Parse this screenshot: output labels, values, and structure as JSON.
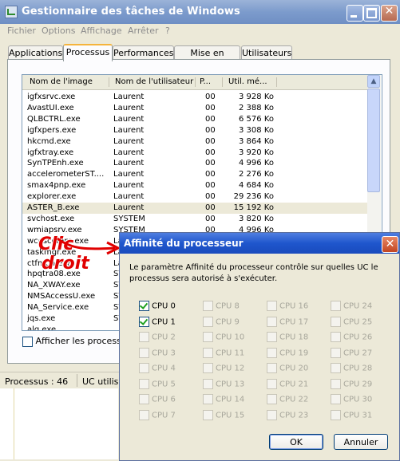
{
  "window": {
    "title": "Gestionnaire des tâches de Windows"
  },
  "menu": [
    "Fichier",
    "Options",
    "Affichage",
    "Arrêter",
    "?"
  ],
  "tabs": [
    "Applications",
    "Processus",
    "Performances",
    "Mise en réseau",
    "Utilisateurs"
  ],
  "active_tab": "Processus",
  "columns": [
    "Nom de l'image",
    "Nom de l'utilisateur",
    "P...",
    "Util. mé..."
  ],
  "processes": [
    {
      "name": "igfxsrvc.exe",
      "user": "Laurent",
      "cpu": "00",
      "mem": "3 928 Ko"
    },
    {
      "name": "AvastUI.exe",
      "user": "Laurent",
      "cpu": "00",
      "mem": "2 388 Ko"
    },
    {
      "name": "QLBCTRL.exe",
      "user": "Laurent",
      "cpu": "00",
      "mem": "6 576 Ko"
    },
    {
      "name": "igfxpers.exe",
      "user": "Laurent",
      "cpu": "00",
      "mem": "3 308 Ko"
    },
    {
      "name": "hkcmd.exe",
      "user": "Laurent",
      "cpu": "00",
      "mem": "3 864 Ko"
    },
    {
      "name": "igfxtray.exe",
      "user": "Laurent",
      "cpu": "00",
      "mem": "3 920 Ko"
    },
    {
      "name": "SynTPEnh.exe",
      "user": "Laurent",
      "cpu": "00",
      "mem": "4 996 Ko"
    },
    {
      "name": "accelerometerST....",
      "user": "Laurent",
      "cpu": "00",
      "mem": "2 276 Ko"
    },
    {
      "name": "smax4pnp.exe",
      "user": "Laurent",
      "cpu": "00",
      "mem": "4 684 Ko"
    },
    {
      "name": "explorer.exe",
      "user": "Laurent",
      "cpu": "00",
      "mem": "29 236 Ko"
    },
    {
      "name": "ASTER_B.exe",
      "user": "Laurent",
      "cpu": "00",
      "mem": "15 192 Ko"
    },
    {
      "name": "svchost.exe",
      "user": "SYSTEM",
      "cpu": "00",
      "mem": "3 820 Ko"
    },
    {
      "name": "wmiapsrv.exe",
      "user": "SYSTEM",
      "cpu": "00",
      "mem": "4 996 Ko"
    },
    {
      "name": "wcescomm.exe",
      "user": "La",
      "cpu": "",
      "mem": ""
    },
    {
      "name": "taskmgr.exe",
      "user": "La",
      "cpu": "",
      "mem": ""
    },
    {
      "name": "ctfmon.exe",
      "user": "La",
      "cpu": "",
      "mem": ""
    },
    {
      "name": "hpqtra08.exe",
      "user": "SY",
      "cpu": "",
      "mem": ""
    },
    {
      "name": "NA_XWAY.exe",
      "user": "SY",
      "cpu": "",
      "mem": ""
    },
    {
      "name": "NMSAccessU.exe",
      "user": "SY",
      "cpu": "",
      "mem": ""
    },
    {
      "name": "NA_Service.exe",
      "user": "SY",
      "cpu": "",
      "mem": ""
    },
    {
      "name": "jqs.exe",
      "user": "SY",
      "cpu": "",
      "mem": ""
    },
    {
      "name": "alg.exe",
      "user": "",
      "cpu": "",
      "mem": ""
    }
  ],
  "selected_process_index": 10,
  "show_all_label": "Afficher les processus",
  "status": {
    "processes": "Processus : 46",
    "cpu": "UC utilisé"
  },
  "annotation": [
    "Clic",
    "droit"
  ],
  "dialog": {
    "title": "Affinité du processeur",
    "description": "Le paramètre Affinité du processeur contrôle sur quelles UC le processus sera autorisé à s'exécuter.",
    "cpus": [
      {
        "label": "CPU 0",
        "checked": true,
        "enabled": true
      },
      {
        "label": "CPU 1",
        "checked": true,
        "enabled": true
      },
      {
        "label": "CPU 2",
        "checked": false,
        "enabled": false
      },
      {
        "label": "CPU 3",
        "checked": false,
        "enabled": false
      },
      {
        "label": "CPU 4",
        "checked": false,
        "enabled": false
      },
      {
        "label": "CPU 5",
        "checked": false,
        "enabled": false
      },
      {
        "label": "CPU 6",
        "checked": false,
        "enabled": false
      },
      {
        "label": "CPU 7",
        "checked": false,
        "enabled": false
      },
      {
        "label": "CPU 8",
        "checked": false,
        "enabled": false
      },
      {
        "label": "CPU 9",
        "checked": false,
        "enabled": false
      },
      {
        "label": "CPU 10",
        "checked": false,
        "enabled": false
      },
      {
        "label": "CPU 11",
        "checked": false,
        "enabled": false
      },
      {
        "label": "CPU 12",
        "checked": false,
        "enabled": false
      },
      {
        "label": "CPU 13",
        "checked": false,
        "enabled": false
      },
      {
        "label": "CPU 14",
        "checked": false,
        "enabled": false
      },
      {
        "label": "CPU 15",
        "checked": false,
        "enabled": false
      },
      {
        "label": "CPU 16",
        "checked": false,
        "enabled": false
      },
      {
        "label": "CPU 17",
        "checked": false,
        "enabled": false
      },
      {
        "label": "CPU 18",
        "checked": false,
        "enabled": false
      },
      {
        "label": "CPU 19",
        "checked": false,
        "enabled": false
      },
      {
        "label": "CPU 20",
        "checked": false,
        "enabled": false
      },
      {
        "label": "CPU 21",
        "checked": false,
        "enabled": false
      },
      {
        "label": "CPU 22",
        "checked": false,
        "enabled": false
      },
      {
        "label": "CPU 23",
        "checked": false,
        "enabled": false
      },
      {
        "label": "CPU 24",
        "checked": false,
        "enabled": false
      },
      {
        "label": "CPU 25",
        "checked": false,
        "enabled": false
      },
      {
        "label": "CPU 26",
        "checked": false,
        "enabled": false
      },
      {
        "label": "CPU 27",
        "checked": false,
        "enabled": false
      },
      {
        "label": "CPU 28",
        "checked": false,
        "enabled": false
      },
      {
        "label": "CPU 29",
        "checked": false,
        "enabled": false
      },
      {
        "label": "CPU 30",
        "checked": false,
        "enabled": false
      },
      {
        "label": "CPU 31",
        "checked": false,
        "enabled": false
      }
    ],
    "ok_label": "OK",
    "cancel_label": "Annuler"
  }
}
